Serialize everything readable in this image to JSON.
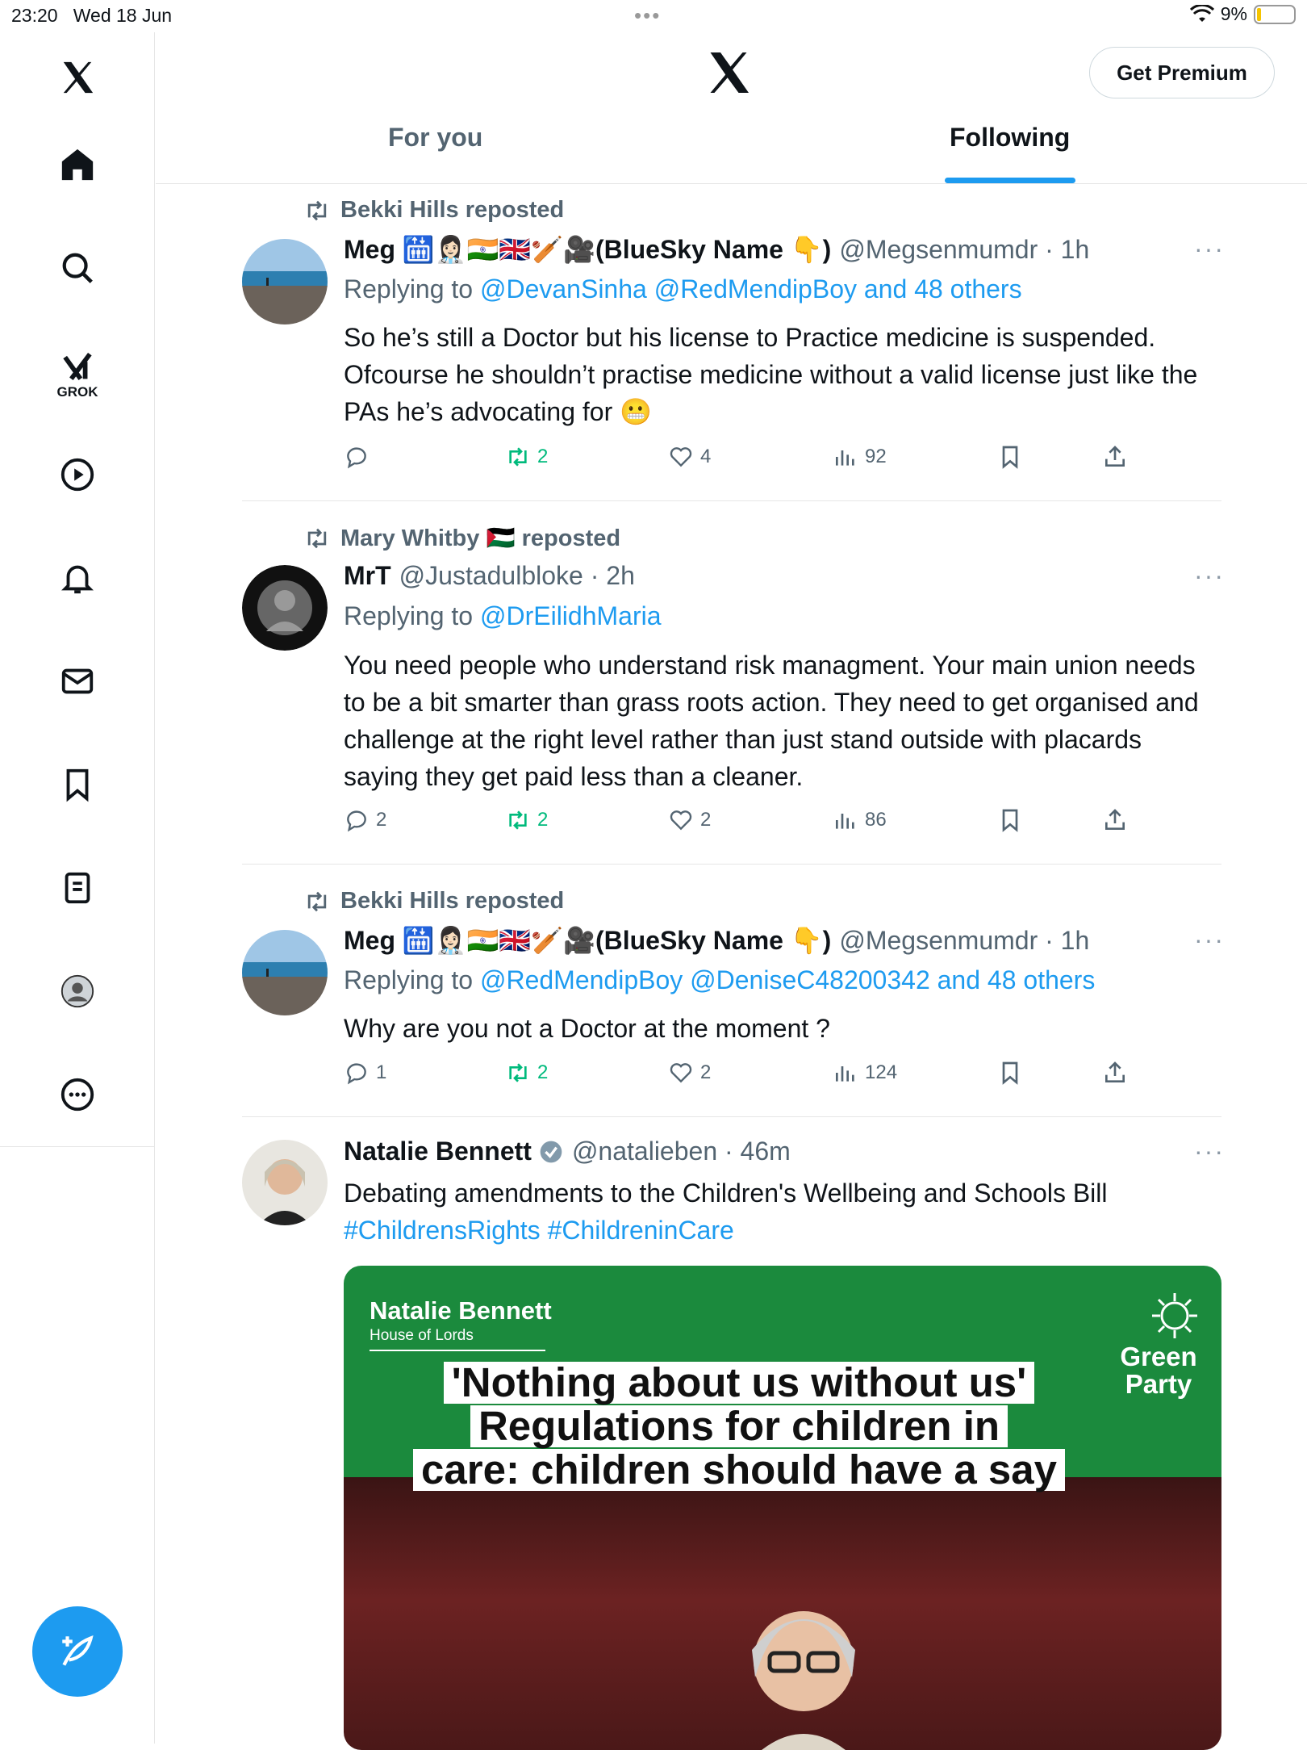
{
  "status_bar": {
    "time": "23:20",
    "date": "Wed 18 Jun",
    "battery": "9%",
    "battery_level": 0.09
  },
  "sidebar": {
    "items": [
      {
        "name": "home-icon"
      },
      {
        "name": "search-icon"
      },
      {
        "name": "grok-icon",
        "label": "GROK"
      },
      {
        "name": "video-icon"
      },
      {
        "name": "notifications-icon"
      },
      {
        "name": "messages-icon"
      },
      {
        "name": "bookmarks-icon"
      },
      {
        "name": "lists-icon"
      },
      {
        "name": "profile-icon"
      },
      {
        "name": "more-icon"
      }
    ]
  },
  "header": {
    "premium_label": "Get Premium",
    "tabs": [
      {
        "label": "For you",
        "active": false
      },
      {
        "label": "Following",
        "active": true
      }
    ]
  },
  "tweets": [
    {
      "reposted_by": "Bekki Hills reposted",
      "name": "Meg 🛗👩🏻‍⚕️🇮🇳🇬🇧🏏🎥(BlueSky Name 👇)",
      "handle": "@Megsenmumdr · 1h",
      "replying_prefix": "Replying to",
      "replying_links": "@DevanSinha @RedMendipBoy and 48 others",
      "text": "So he’s still a Doctor but his license to Practice medicine is suspended. Ofcourse he shouldn’t practise medicine without a valid license just like the PAs he’s advocating for 😬",
      "replies": "",
      "reposts": "2",
      "likes": "4",
      "views": "92"
    },
    {
      "reposted_by": "Mary Whitby 🇵🇸 reposted",
      "name": "MrT",
      "handle": "@Justadulbloke · 2h",
      "replying_prefix": "Replying to",
      "replying_links": "@DrEilidhMaria",
      "text": "You need people who understand risk managment. Your main union needs to be a bit smarter than grass roots action.  They need to get organised and challenge at the right level rather than just stand outside with placards saying they get paid less than a cleaner.",
      "replies": "2",
      "reposts": "2",
      "likes": "2",
      "views": "86"
    },
    {
      "reposted_by": "Bekki Hills reposted",
      "name": "Meg 🛗👩🏻‍⚕️🇮🇳🇬🇧🏏🎥(BlueSky Name 👇)",
      "handle": "@Megsenmumdr · 1h",
      "replying_prefix": "Replying to",
      "replying_links": "@RedMendipBoy @DeniseC48200342 and 48 others",
      "text": "Why are you not a Doctor at the moment ?",
      "replies": "1",
      "reposts": "2",
      "likes": "2",
      "views": "124"
    },
    {
      "name": "Natalie Bennett",
      "handle": "@natalieben · 46m",
      "text": "Debating amendments to the Children's Wellbeing and Schools Bill",
      "hashtags": "#ChildrensRights #ChildreninCare",
      "media": {
        "name": "Natalie Bennett",
        "subtitle": "House of Lords",
        "party": "Green Party",
        "headline": [
          "'Nothing about us without us'",
          "Regulations for children in",
          "care: children should have a say"
        ]
      }
    }
  ],
  "colors": {
    "accent": "#1d9bf0",
    "repost_green": "#00ba7c",
    "muted": "#536471",
    "green_party": "#1b8a3d"
  }
}
